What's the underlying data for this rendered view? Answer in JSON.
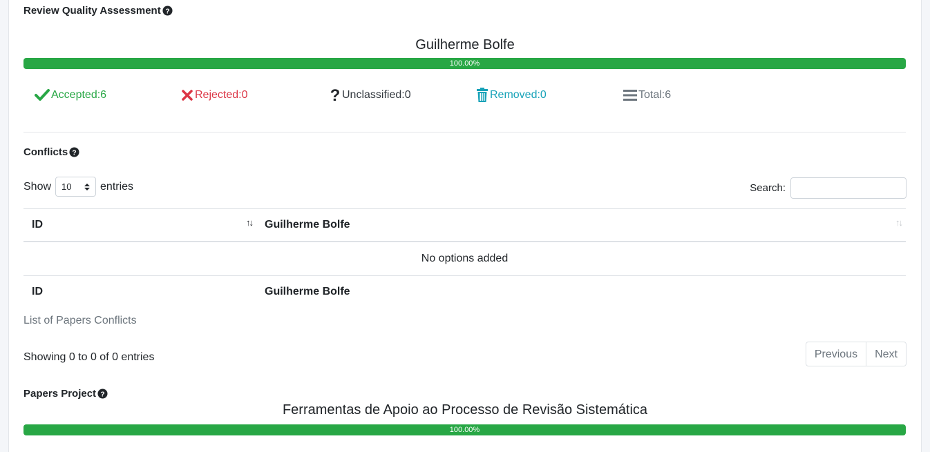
{
  "review": {
    "title": "Review Quality Assessment",
    "reviewer": "Guilherme Bolfe",
    "progress_label": "100.00%",
    "progress_percent": 100,
    "stats": {
      "accepted_label": "Accepted:",
      "accepted_value": "6",
      "rejected_label": "Rejected:",
      "rejected_value": "0",
      "unclassified_label": "Unclassified:",
      "unclassified_value": "0",
      "removed_label": "Removed:",
      "removed_value": "0",
      "total_label": "Total:",
      "total_value": "6"
    }
  },
  "conflicts": {
    "title": "Conflicts",
    "show_label": "Show",
    "page_size": "10",
    "entries_label": "entries",
    "search_label": "Search:",
    "search_value": "",
    "columns": [
      "ID",
      "Guilherme Bolfe"
    ],
    "empty_message": "No options added",
    "footer_columns": [
      "ID",
      "Guilherme Bolfe"
    ],
    "caption": "List of Papers Conflicts",
    "info": "Showing 0 to 0 of 0 entries",
    "prev_label": "Previous",
    "next_label": "Next"
  },
  "project": {
    "title": "Papers Project",
    "name": "Ferramentas de Apoio ao Processo de Revisão Sistemática",
    "progress_label": "100.00%",
    "progress_percent": 100
  },
  "colors": {
    "success": "#28a745",
    "danger": "#dc3545",
    "info": "#17a2b8",
    "muted": "#6c757d"
  },
  "icons": [
    "question-circle-icon",
    "check-icon",
    "times-icon",
    "question-icon",
    "trash-icon",
    "bars-icon",
    "sort-icon",
    "select-arrows-icon"
  ]
}
